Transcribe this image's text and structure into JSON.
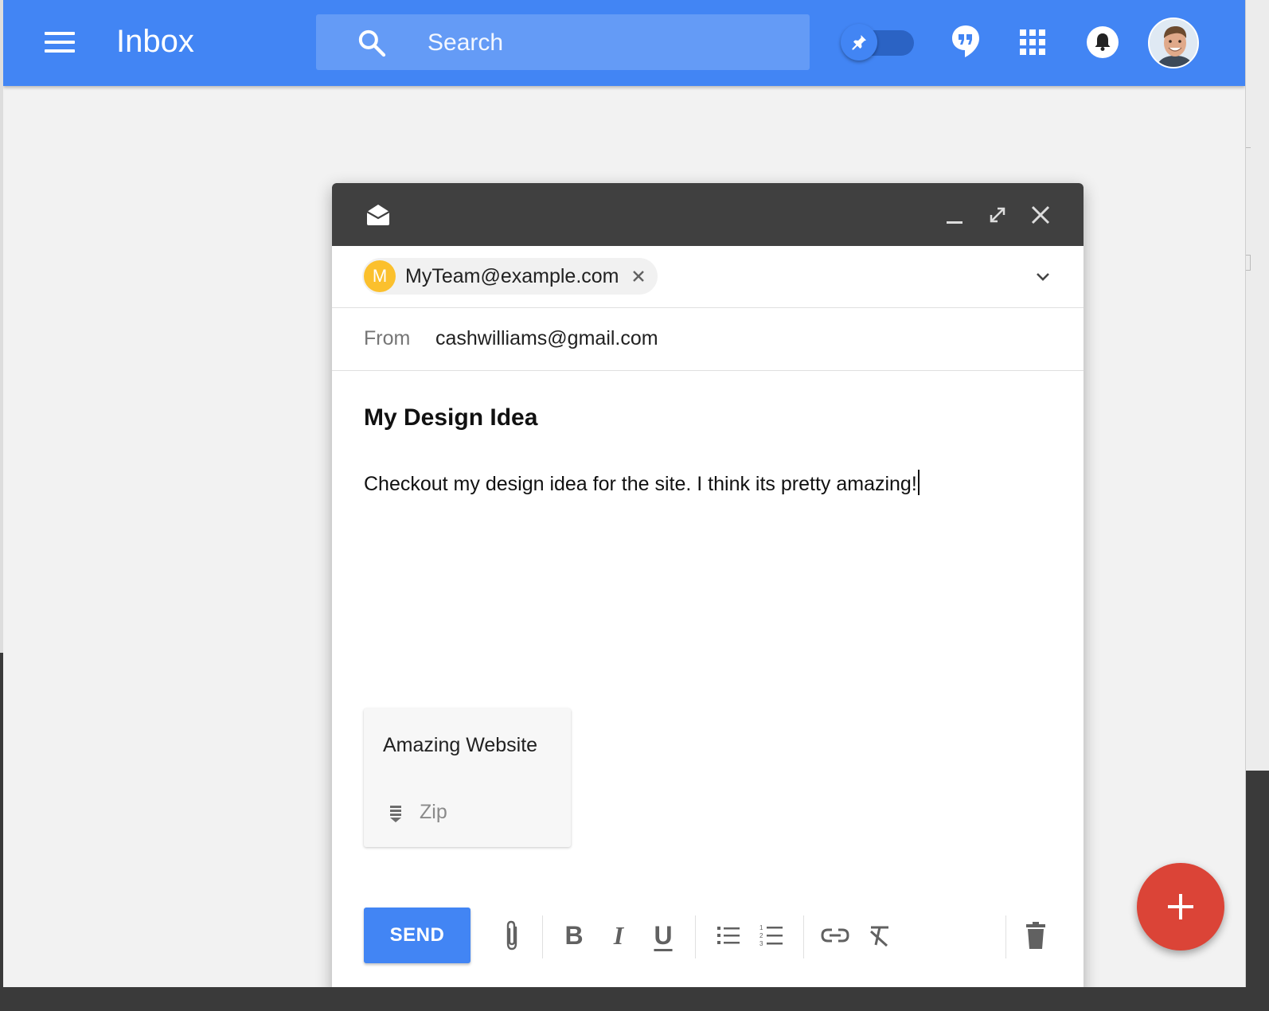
{
  "header": {
    "title": "Inbox",
    "search_placeholder": "Search",
    "menu_icon": "hamburger-menu-icon",
    "pin_toggle_icon": "pin-icon",
    "hangouts_icon": "hangouts-icon",
    "apps_icon": "apps-grid-icon",
    "notifications_icon": "bell-icon",
    "brand_color": "#4285f4"
  },
  "compose": {
    "to_chip": {
      "initial": "M",
      "email": "MyTeam@example.com"
    },
    "from_label": "From",
    "from_value": "cashwilliams@gmail.com",
    "subject": "My Design Idea",
    "body": "Checkout my design idea for the site. I think its pretty amazing!",
    "attachment": {
      "title": "Amazing Website",
      "type": "Zip"
    },
    "send_label": "SEND",
    "header_color": "#404040"
  },
  "fab": {
    "icon": "plus-icon",
    "color": "#db4437"
  }
}
